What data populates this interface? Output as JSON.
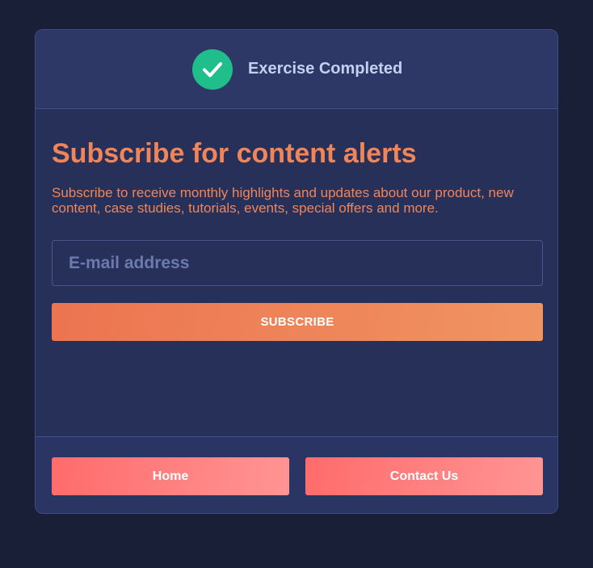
{
  "header": {
    "status_icon": "checkmark-icon",
    "title": "Exercise Completed"
  },
  "subscribe": {
    "title": "Subscribe for content alerts",
    "description": "Subscribe to receive monthly highlights and updates about our product, new content, case studies, tutorials, events, special offers and more.",
    "email_placeholder": "E-mail address",
    "email_value": "",
    "button_label": "SUBSCRIBE"
  },
  "footer": {
    "home_label": "Home",
    "contact_label": "Contact Us"
  },
  "colors": {
    "background": "#1a1f38",
    "card": "#273059",
    "success": "#1fbe8a",
    "accent_orange": "#ef8559",
    "accent_red": "#ff6b6b"
  }
}
